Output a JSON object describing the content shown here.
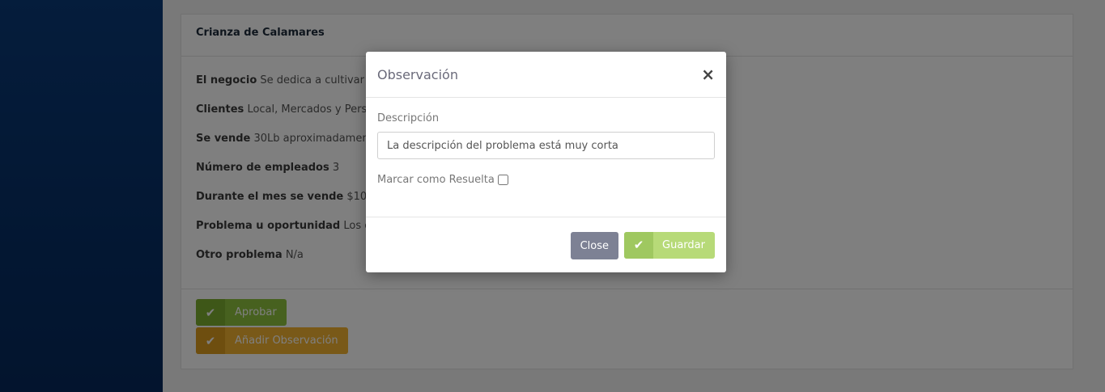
{
  "panel": {
    "title": "Crianza de Calamares",
    "fields": [
      {
        "label": "El negocio",
        "value": "Se dedica a cultivar ca"
      },
      {
        "label": "Clientes",
        "value": "Local, Mercados y Perso"
      },
      {
        "label": "Se vende",
        "value": "30Lb aproximadamente"
      },
      {
        "label": "Número de empleados",
        "value": "3"
      },
      {
        "label": "Durante el mes se vende",
        "value": "$1000.0"
      },
      {
        "label": "Problema u oportunidad",
        "value": "Los cala"
      },
      {
        "label": "Otro problema",
        "value": "N/a"
      }
    ],
    "approve_label": "Aprobar",
    "add_observation_label": "Añadir Observación"
  },
  "modal": {
    "title": "Observación",
    "close_symbol": "×",
    "description_label": "Descripción",
    "description_value": "La descripción del problema está muy corta",
    "resolved_label": "Marcar como Resuelta",
    "close_button": "Close",
    "save_button": "Guardar"
  },
  "icons": {
    "check": "check-icon"
  },
  "colors": {
    "sidebar": "#0b3a78",
    "approve": "#8fc23e",
    "observation": "#f3b230",
    "close_button": "#7d8194",
    "save_button": "#b7da78"
  }
}
